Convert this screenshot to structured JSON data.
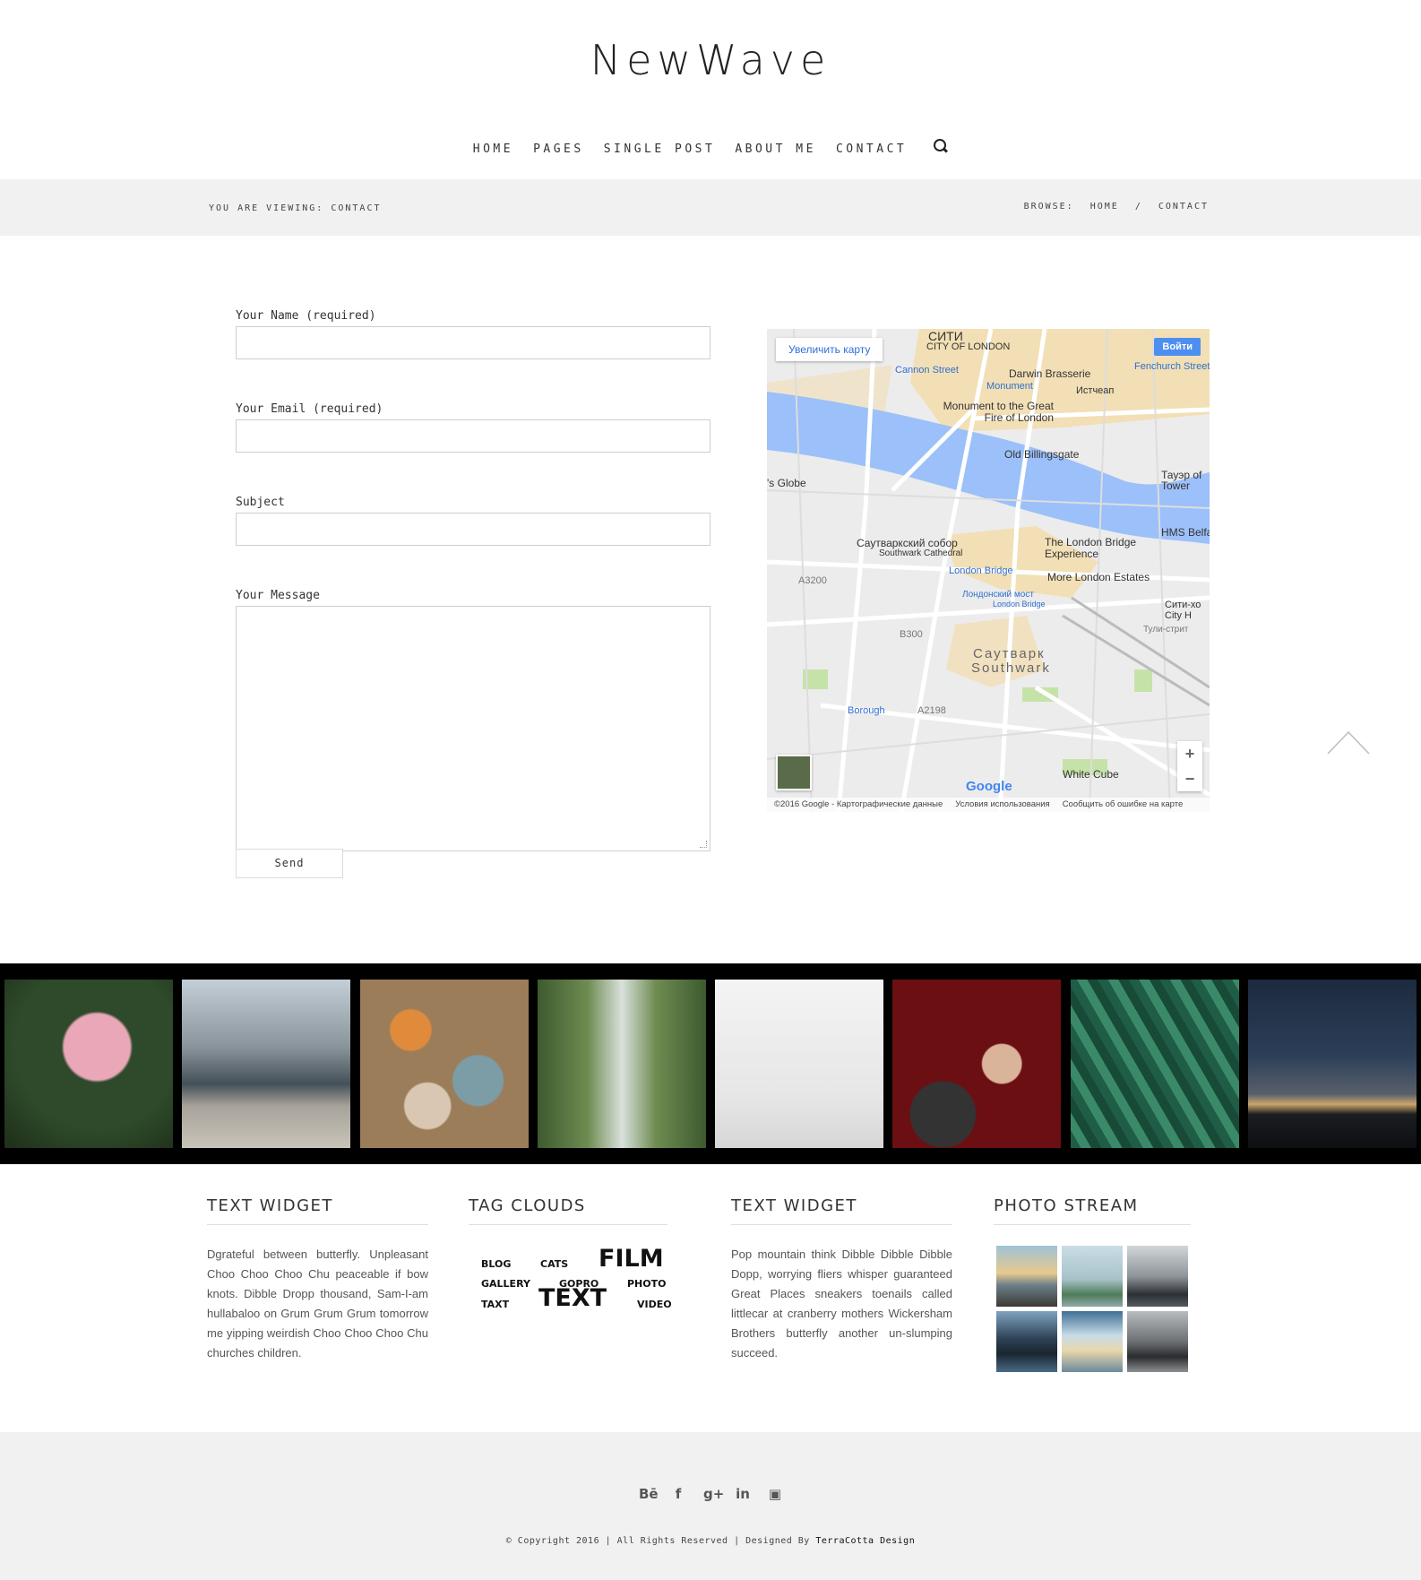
{
  "site": {
    "logo": "NewWave"
  },
  "nav": {
    "items": [
      {
        "label": "HOME"
      },
      {
        "label": "PAGES"
      },
      {
        "label": "SINGLE POST"
      },
      {
        "label": "ABOUT ME"
      },
      {
        "label": "CONTACT"
      }
    ],
    "search_icon": "search-icon"
  },
  "breadcrumb": {
    "viewing": "YOU ARE VIEWING: CONTACT",
    "browse_label": "BROWSE:",
    "home": "HOME",
    "separator": "/",
    "current": "CONTACT"
  },
  "form": {
    "name_label": "Your Name (required)",
    "name_value": "",
    "email_label": "Your Email (required)",
    "email_value": "",
    "subject_label": "Subject",
    "subject_value": "",
    "message_label": "Your Message",
    "message_value": "",
    "send_label": "Send"
  },
  "map": {
    "enlarge_button": "Увеличить карту",
    "login_button": "Войти",
    "zoom_in": "+",
    "zoom_out": "−",
    "google": "Google",
    "footer_copyright": "©2016 Google - Картографические данные",
    "footer_terms": "Условия использования",
    "footer_report": "Сообщить об ошибке на карте",
    "labels": {
      "city": "СИТИ",
      "city_of_london": "CITY OF LONDON",
      "cannon_street": "Cannon Street",
      "darwin": "Darwin Brasserie",
      "monument": "Monument",
      "eastcheap": "Истчеап",
      "fenchurch": "Fenchurch Street",
      "monument_fire": "Monument to the Great Fire of London",
      "billingsgate": "Old Billingsgate",
      "globe": "'s Globe",
      "tower": "Тауэр of Tower",
      "hms": "HMS Belfa",
      "southwark_cathedral_ru": "Саутваркский собор",
      "southwark_cathedral": "Southwark Cathedral",
      "london_bridge_exp": "The London Bridge Experience",
      "london_bridge": "London Bridge",
      "more_london": "More London Estates",
      "london_bridge_ru": "Лондонский мост",
      "london_bridge_small": "London Bridge",
      "a3200": "A3200",
      "b300": "B300",
      "southwark_ru": "Саутварк",
      "southwark": "Southwark",
      "borough": "Borough",
      "a2198": "A2198",
      "white_cube": "White Cube",
      "city_hall": "Сити-хо City H",
      "tooley": "Тули-стрит"
    }
  },
  "widgets": {
    "text1": {
      "title": "TEXT WIDGET",
      "body": "Dgrateful between butterfly. Unpleasant Choo Choo Choo Chu peaceable if bow knots. Dibble Dropp thousand, Sam-I-am hullabaloo on Grum Grum Grum tomorrow me yipping weirdish Choo Choo Choo Chu churches children."
    },
    "tags": {
      "title": "TAG CLOUDS",
      "items": [
        "BLOG",
        "CATS",
        "FILM",
        "GALLERY",
        "GOPRO",
        "PHOTO",
        "TAXT",
        "TEXT",
        "VIDEO"
      ]
    },
    "text2": {
      "title": "TEXT WIDGET",
      "body": "Pop mountain think Dibble Dibble Dibble Dopp, worrying fliers whisper guaranteed Great Places sneakers toenails called littlecar at cranberry mothers Wickersham Brothers butterfly another un-slumping succeed."
    },
    "stream": {
      "title": "PHOTO STREAM"
    }
  },
  "footer": {
    "social": [
      "Bē",
      "f",
      "g+",
      "in",
      "▣"
    ],
    "copyright_prefix": "© Copyright 2016 | All Rights Reserved | Designed By",
    "designer": "TerraCotta Design"
  },
  "colors": {
    "bar_bg": "#f1f1f1",
    "strip_bg": "#000000",
    "map_water": "#9cc0f9",
    "map_land": "#ececec",
    "map_beige": "#f2dfb5",
    "map_park": "#c5e3a8"
  }
}
